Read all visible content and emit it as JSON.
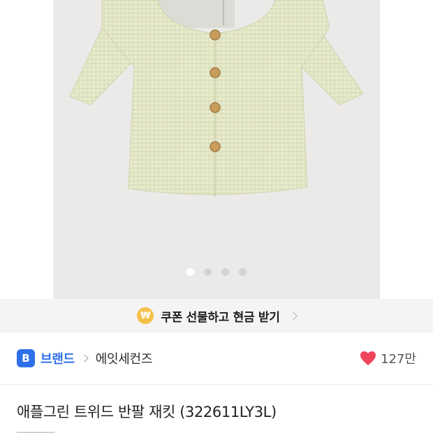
{
  "gallery": {
    "image_alt": "apple green tweed short sleeve jacket",
    "slide_count": 4,
    "active_slide": 1
  },
  "coupon": {
    "icon": "won-coin-icon",
    "icon_glyph": "₩",
    "label": "쿠폰 선물하고 현금 받기"
  },
  "brand": {
    "badge": "B",
    "label": "브랜드",
    "name": "에잇세컨즈"
  },
  "likes": {
    "icon": "heart-icon",
    "count": "127만",
    "color": "#f0445a"
  },
  "product": {
    "title": "애플그린 트위드 반팔 재킷 (322611LY3L)"
  },
  "colors": {
    "accent": "#2f6fea",
    "coin": "#f5c04a"
  }
}
